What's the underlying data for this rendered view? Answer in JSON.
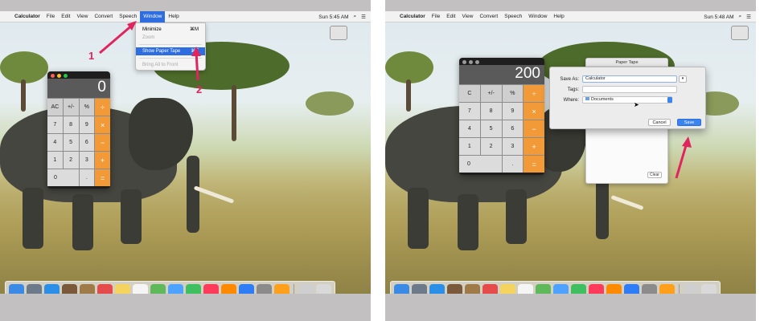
{
  "left": {
    "menubar": {
      "app_name": "Calculator",
      "items": [
        "File",
        "Edit",
        "View",
        "Convert",
        "Speech",
        "Window",
        "Help"
      ],
      "active_item": "Window",
      "clock": "Sun 5:45 AM"
    },
    "window_menu": {
      "items": [
        {
          "label": "Minimize",
          "shortcut": "⌘M",
          "state": "normal"
        },
        {
          "label": "Zoom",
          "shortcut": "",
          "state": "disabled"
        },
        {
          "label": "Show Paper Tape",
          "shortcut": "⌘T",
          "state": "highlighted"
        },
        {
          "label": "Bring All to Front",
          "shortcut": "",
          "state": "disabled"
        }
      ]
    },
    "calculator": {
      "display": "0",
      "keys": [
        "AC",
        "+/-",
        "%",
        "÷",
        "7",
        "8",
        "9",
        "×",
        "4",
        "5",
        "6",
        "−",
        "1",
        "2",
        "3",
        "+",
        "0",
        ".",
        "="
      ]
    },
    "annotations": {
      "step1": "1",
      "step2": "2"
    }
  },
  "right": {
    "menubar": {
      "app_name": "Calculator",
      "items": [
        "File",
        "Edit",
        "View",
        "Convert",
        "Speech",
        "Window",
        "Help"
      ],
      "clock": "Sun 5:48 AM"
    },
    "calculator": {
      "display": "200",
      "keys": [
        "C",
        "+/-",
        "%",
        "÷",
        "7",
        "8",
        "9",
        "×",
        "4",
        "5",
        "6",
        "−",
        "1",
        "2",
        "3",
        "+",
        "0",
        ".",
        "="
      ]
    },
    "paper_tape": {
      "title": "Paper Tape",
      "clear_label": "Clear"
    },
    "save_dialog": {
      "save_as_label": "Save As:",
      "save_as_value": "Calculator",
      "tags_label": "Tags:",
      "where_label": "Where:",
      "where_value": "Documents",
      "cancel_label": "Cancel",
      "save_label": "Save"
    }
  },
  "dock_icons": [
    "finder-icon",
    "launchpad-icon",
    "safari-icon",
    "photos-icon",
    "contacts-icon",
    "calendar-icon",
    "notes-icon",
    "reminders-icon",
    "maps-icon",
    "messages-icon",
    "facetime-icon",
    "music-icon",
    "books-icon",
    "appstore-icon",
    "system-preferences-icon",
    "calculator-icon",
    "downloads-icon",
    "trash-icon"
  ],
  "colors": {
    "accent": "#2d6de0",
    "calc_operator": "#f19a37",
    "annotation": "#e0245e"
  }
}
